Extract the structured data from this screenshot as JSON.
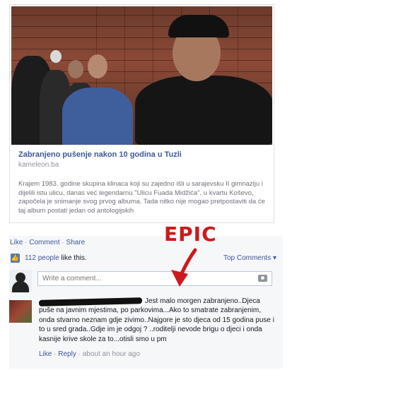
{
  "post": {
    "link_title": "Zabranjeno pušenje nakon 10 godina u Tuzli",
    "link_domain": "kameleon.ba",
    "link_description": "Krajem 1983. godine skupina klinaca koji su zajedno išli u sarajevsku II gimnaziju i dijelili istu ulicu, danas već legendarnu \"Ulicu Fuada Midžića\", u kvartu Koševo, započela je snimanje svog prvog albuma. Tada nitko nije mogao pretpostaviti da će taj album postati jedan od antologijskih"
  },
  "actions": {
    "like": "Like",
    "comment": "Comment",
    "share": "Share",
    "separator": "·"
  },
  "likes": {
    "link_text": "112 people",
    "rest_text": " like this.",
    "top_comments": "Top Comments ▾"
  },
  "composer": {
    "placeholder": "Write a comment..."
  },
  "comment": {
    "text": "Jest malo morgen zabranjeno..Djeca puše na javnim mjestima, po parkovima...Ako to smatrate zabranjenim, onda stvarno neznam gdje zivimo..Najgore je sto djeca od 15 godina puse i to u sred grada..Gdje im je odgoj ? ..roditelji nevode brigu o djeci i onda kasnije krive skole za to...otisli smo u pm",
    "like": "Like",
    "reply": "Reply",
    "time": "about an hour ago"
  },
  "annotation": {
    "label": "EPIC",
    "color": "#cc1a1a"
  },
  "icons": {
    "like": "thumbs-up-icon",
    "camera": "camera-icon",
    "arrow": "arrow-down-icon"
  },
  "colors": {
    "link": "#3b5998",
    "muted": "#90949c",
    "panel": "#f6f7f9"
  }
}
